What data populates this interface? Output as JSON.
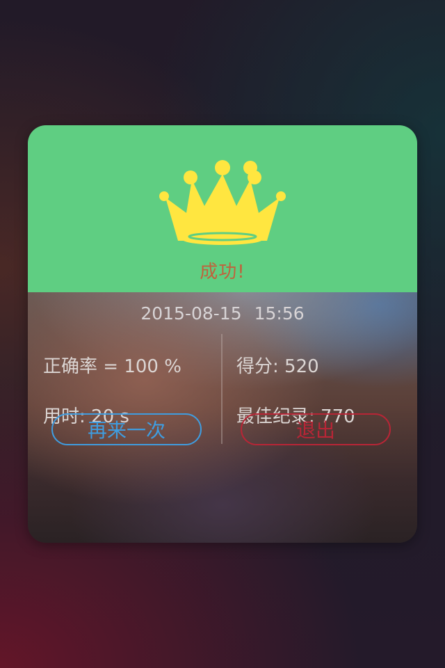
{
  "result": {
    "title": "成功!",
    "icon": "crown-icon",
    "crown_color": "#ffe640",
    "header_color": "#5fce82"
  },
  "datetime": {
    "date": "2015-08-15",
    "time": "15:56"
  },
  "stats": {
    "accuracy_label": "正确率 = ",
    "accuracy_value": "100 %",
    "score_label": "得分: ",
    "score_value": "520",
    "time_used_label": "用时: ",
    "time_used_value": "20 s",
    "best_record_label": "最佳纪录: ",
    "best_record_value": "770"
  },
  "buttons": {
    "retry_label": "再来一次",
    "exit_label": "退出",
    "retry_color": "#3f9de0",
    "exit_color": "#b82536"
  }
}
